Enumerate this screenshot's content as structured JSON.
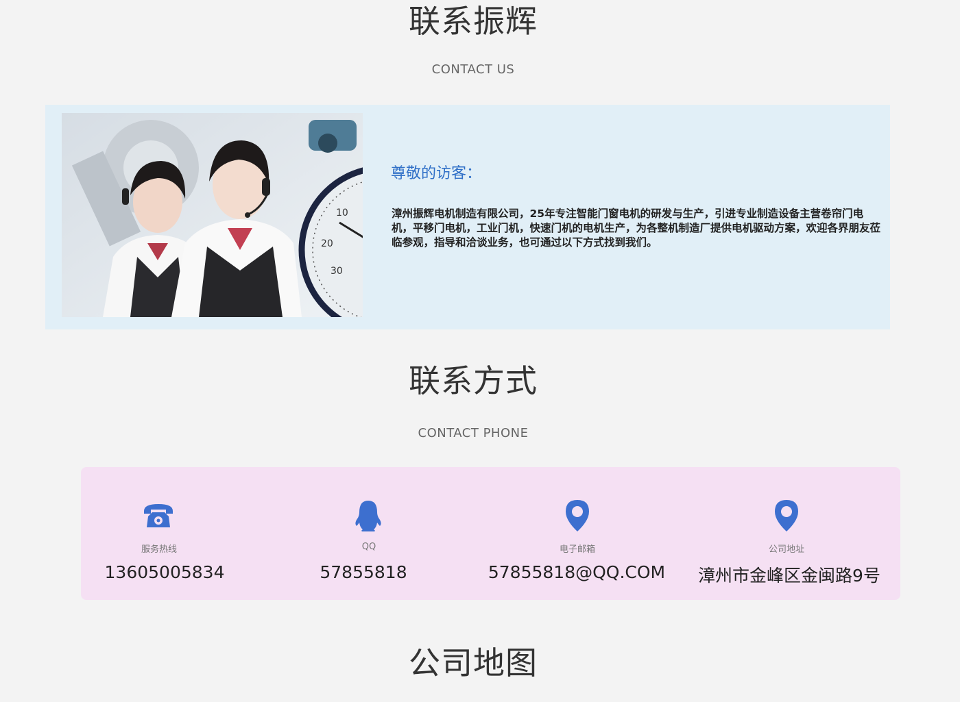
{
  "section_about": {
    "title": "联系振辉",
    "subtitle": "CONTACT US",
    "greeting": "尊敬的访客：",
    "paragraph": "漳州振辉电机制造有限公司，25年专注智能门窗电机的研发与生产，引进专业制造设备主营卷帘门电机，平移门电机，工业门机，快速门机的电机生产，为各整机制造厂提供电机驱动方案，欢迎各界朋友莅临参观，指导和洽谈业务，也可通过以下方式找到我们。"
  },
  "section_contact": {
    "title": "联系方式",
    "subtitle": "CONTACT PHONE",
    "items": [
      {
        "icon": "telephone-icon",
        "label": "服务热线",
        "value": "13605005834"
      },
      {
        "icon": "qq-penguin-icon",
        "label": "QQ",
        "value": "57855818"
      },
      {
        "icon": "location-pin-icon",
        "label": "电子邮箱",
        "value": "57855818@QQ.COM"
      },
      {
        "icon": "location-pin-icon",
        "label": "公司地址",
        "value": "漳州市金峰区金闽路9号"
      }
    ]
  },
  "section_map": {
    "title": "公司地图"
  },
  "colors": {
    "page_background": "#f3f3f3",
    "intro_background": "#e1eff7",
    "contact_background": "#f5e0f3",
    "icon_blue": "#3d6fcf",
    "greeting_blue": "#2f6fc7"
  }
}
